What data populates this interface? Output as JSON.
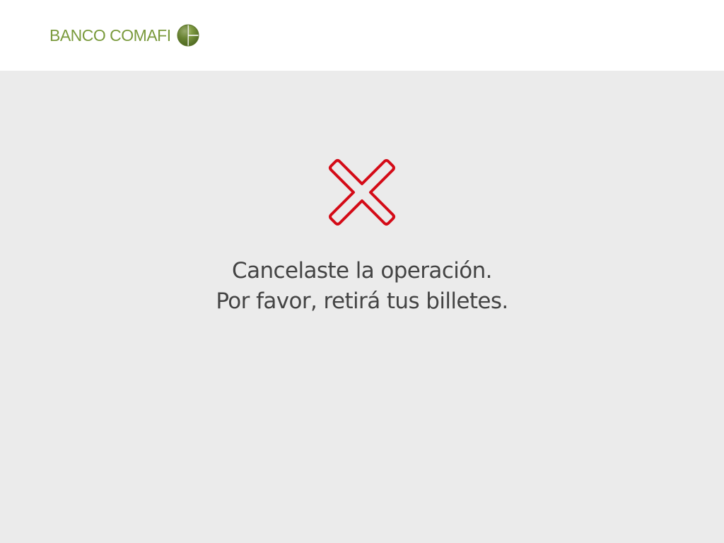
{
  "header": {
    "brand_name": "BANCO COMAFI",
    "brand_color": "#7a9a3c",
    "logo_icon": "globe-logo-icon"
  },
  "status": {
    "icon": "cancel-x-icon",
    "icon_color": "#d40b17",
    "message_line1": "Cancelaste la operación.",
    "message_line2": "Por favor, retirá tus billetes."
  },
  "colors": {
    "background": "#ebebeb",
    "header_background": "#ffffff",
    "text": "#444444"
  }
}
